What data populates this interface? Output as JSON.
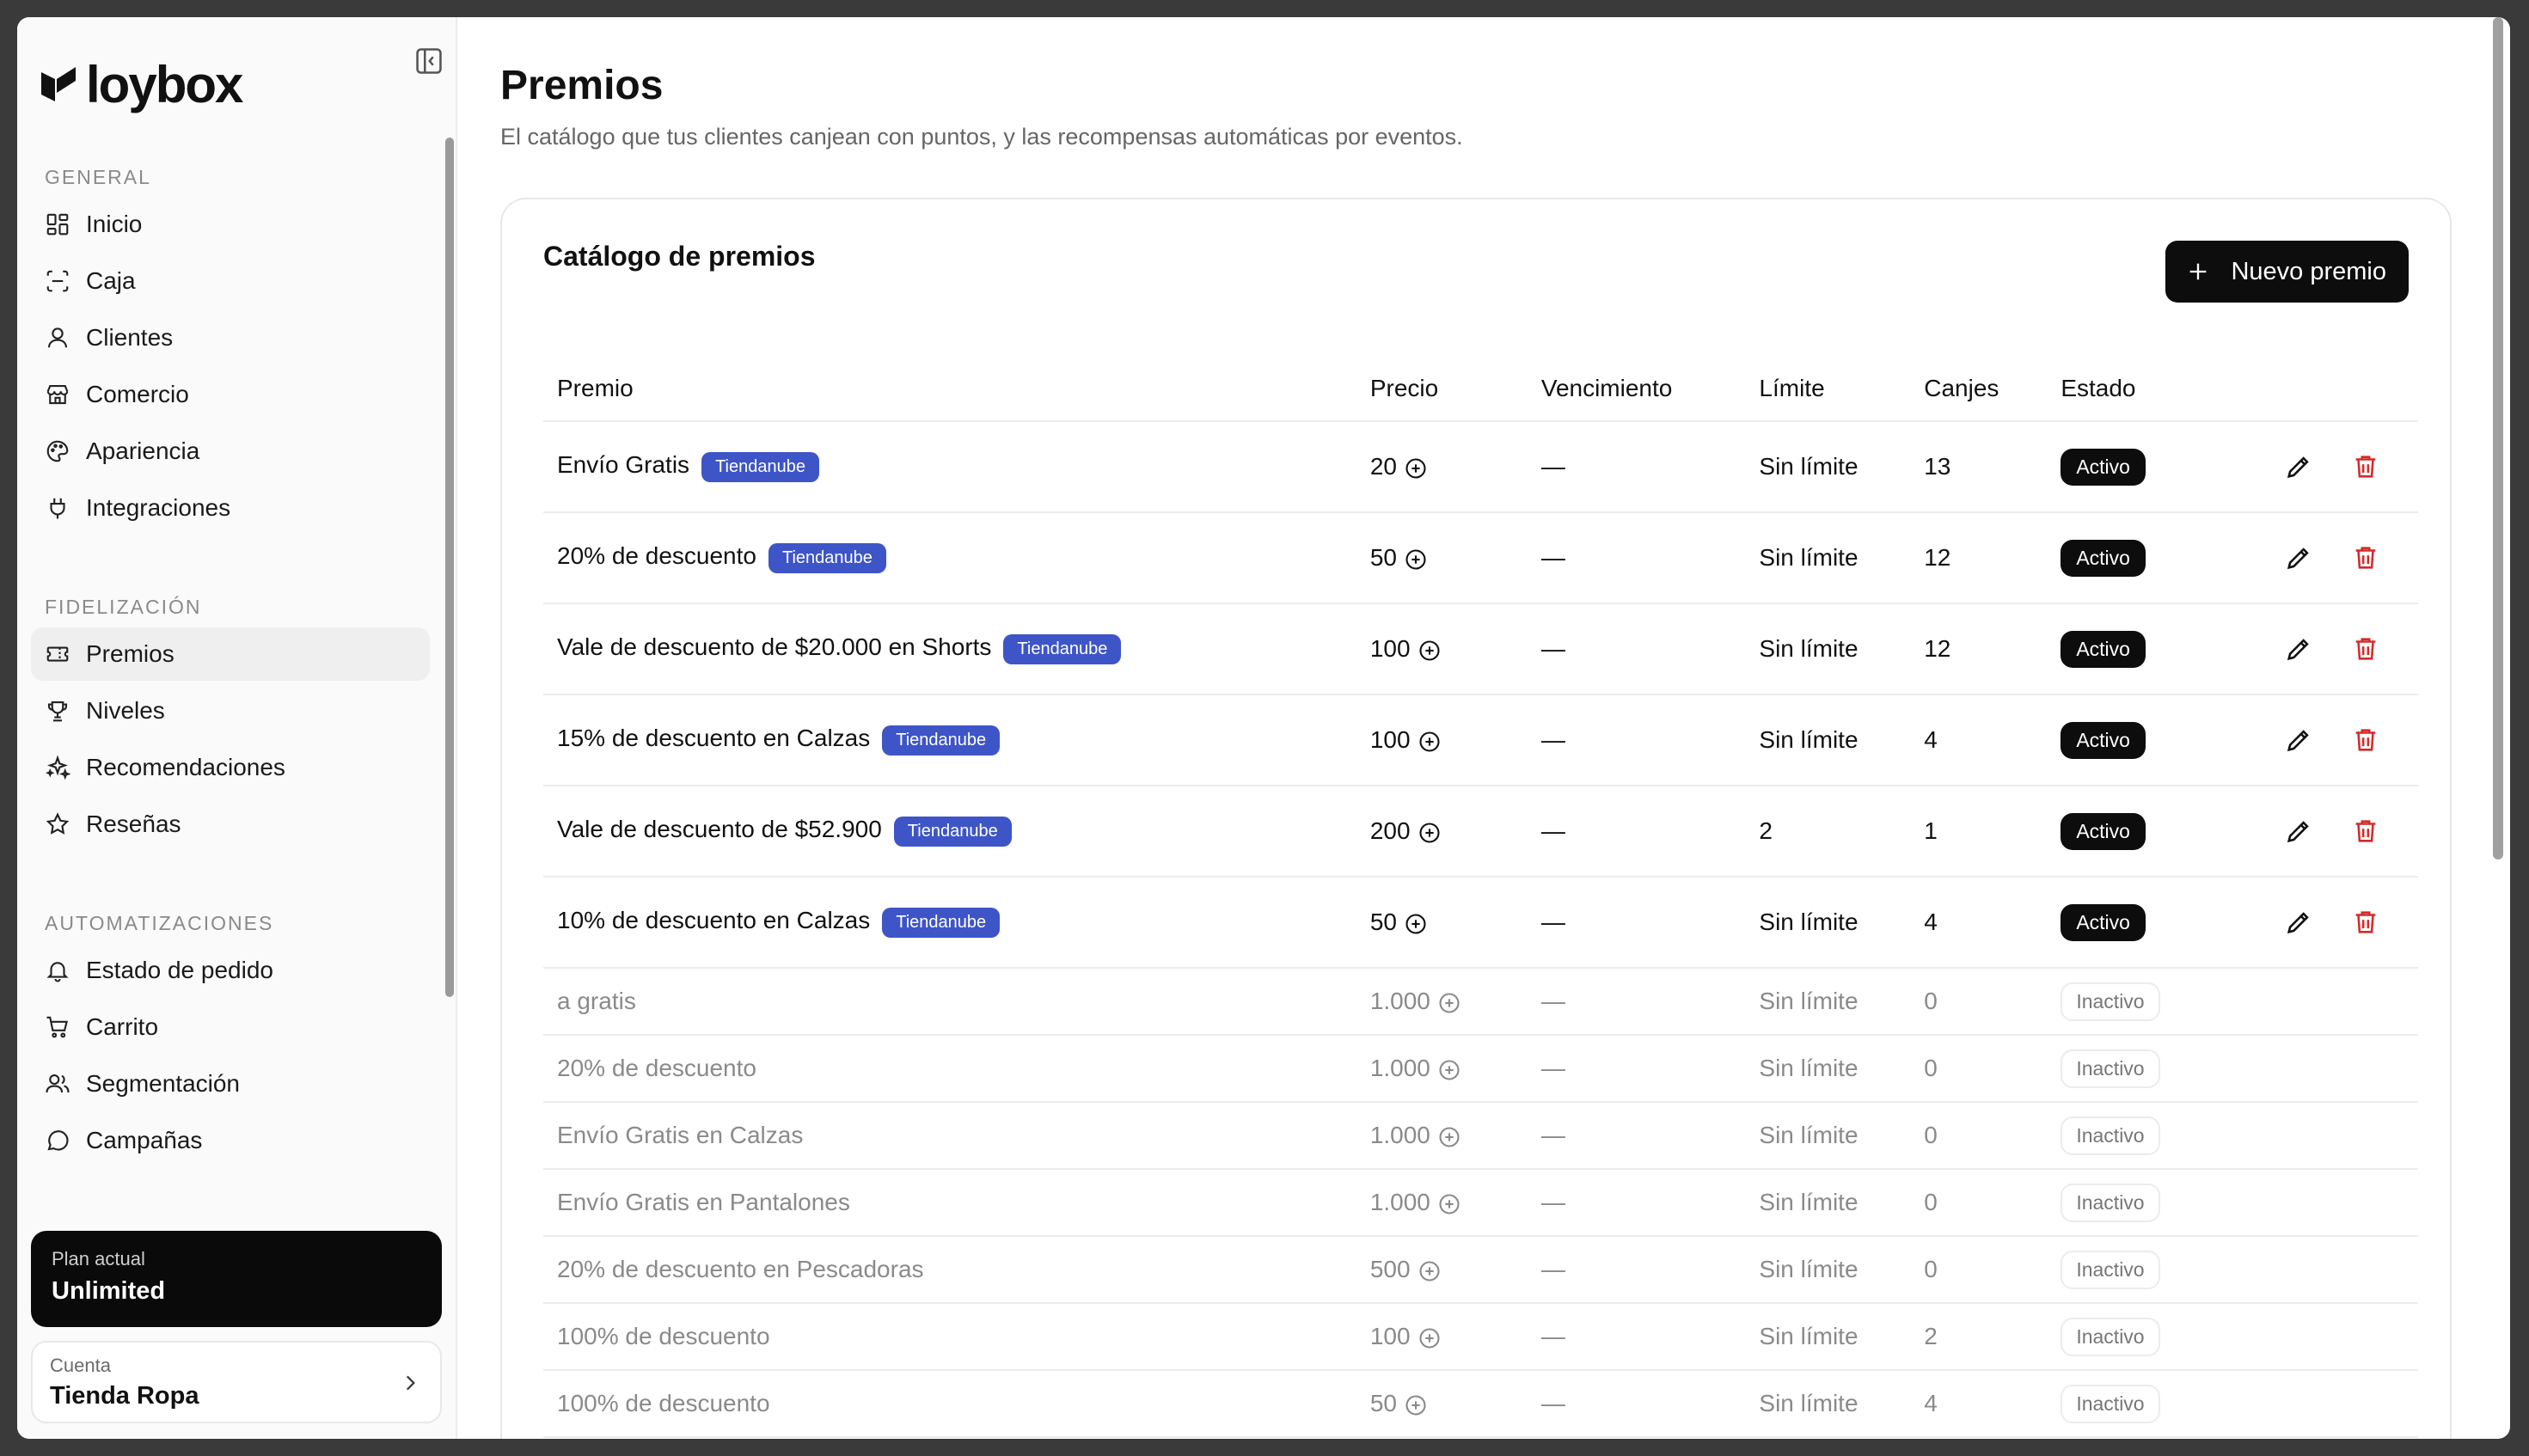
{
  "app": {
    "name": "loybox"
  },
  "sidebar": {
    "sections": [
      {
        "title": "GENERAL",
        "items": [
          {
            "label": "Inicio",
            "icon": "grid-icon"
          },
          {
            "label": "Caja",
            "icon": "scan-icon"
          },
          {
            "label": "Clientes",
            "icon": "user-icon"
          },
          {
            "label": "Comercio",
            "icon": "store-icon"
          },
          {
            "label": "Apariencia",
            "icon": "palette-icon"
          },
          {
            "label": "Integraciones",
            "icon": "plug-icon"
          }
        ]
      },
      {
        "title": "FIDELIZACIÓN",
        "items": [
          {
            "label": "Premios",
            "icon": "ticket-icon",
            "active": true
          },
          {
            "label": "Niveles",
            "icon": "trophy-icon"
          },
          {
            "label": "Recomendaciones",
            "icon": "sparkles-icon"
          },
          {
            "label": "Reseñas",
            "icon": "star-icon"
          }
        ]
      },
      {
        "title": "AUTOMATIZACIONES",
        "items": [
          {
            "label": "Estado de pedido",
            "icon": "bell-icon"
          },
          {
            "label": "Carrito",
            "icon": "cart-icon"
          },
          {
            "label": "Segmentación",
            "icon": "users-icon"
          },
          {
            "label": "Campañas",
            "icon": "chat-icon"
          }
        ]
      }
    ],
    "plan": {
      "label": "Plan actual",
      "value": "Unlimited"
    },
    "account": {
      "label": "Cuenta",
      "value": "Tienda Ropa"
    }
  },
  "page": {
    "title": "Premios",
    "subtitle": "El catálogo que tus clientes canjean con puntos, y las recompensas automáticas por eventos."
  },
  "catalog": {
    "title": "Catálogo de premios",
    "new_button": "Nuevo premio",
    "columns": [
      "Premio",
      "Precio",
      "Vencimiento",
      "Límite",
      "Canjes",
      "Estado"
    ],
    "rows": [
      {
        "name": "Envío Gratis",
        "badge": "Tiendanube",
        "price": "20",
        "expiry": "—",
        "limit": "Sin límite",
        "redeems": "13",
        "status": "Activo",
        "active": true
      },
      {
        "name": "20% de descuento",
        "badge": "Tiendanube",
        "price": "50",
        "expiry": "—",
        "limit": "Sin límite",
        "redeems": "12",
        "status": "Activo",
        "active": true
      },
      {
        "name": "Vale de descuento de $20.000 en Shorts",
        "badge": "Tiendanube",
        "price": "100",
        "expiry": "—",
        "limit": "Sin límite",
        "redeems": "12",
        "status": "Activo",
        "active": true
      },
      {
        "name": "15% de descuento en Calzas",
        "badge": "Tiendanube",
        "price": "100",
        "expiry": "—",
        "limit": "Sin límite",
        "redeems": "4",
        "status": "Activo",
        "active": true
      },
      {
        "name": "Vale de descuento de $52.900",
        "badge": "Tiendanube",
        "price": "200",
        "expiry": "—",
        "limit": "2",
        "redeems": "1",
        "status": "Activo",
        "active": true
      },
      {
        "name": "10% de descuento en Calzas",
        "badge": "Tiendanube",
        "price": "50",
        "expiry": "—",
        "limit": "Sin límite",
        "redeems": "4",
        "status": "Activo",
        "active": true
      },
      {
        "name": "a gratis",
        "badge": "",
        "price": "1.000",
        "expiry": "—",
        "limit": "Sin límite",
        "redeems": "0",
        "status": "Inactivo",
        "active": false
      },
      {
        "name": "20% de descuento",
        "badge": "",
        "price": "1.000",
        "expiry": "—",
        "limit": "Sin límite",
        "redeems": "0",
        "status": "Inactivo",
        "active": false
      },
      {
        "name": "Envío Gratis en Calzas",
        "badge": "",
        "price": "1.000",
        "expiry": "—",
        "limit": "Sin límite",
        "redeems": "0",
        "status": "Inactivo",
        "active": false
      },
      {
        "name": "Envío Gratis en Pantalones",
        "badge": "",
        "price": "1.000",
        "expiry": "—",
        "limit": "Sin límite",
        "redeems": "0",
        "status": "Inactivo",
        "active": false
      },
      {
        "name": "20% de descuento en Pescadoras",
        "badge": "",
        "price": "500",
        "expiry": "—",
        "limit": "Sin límite",
        "redeems": "0",
        "status": "Inactivo",
        "active": false
      },
      {
        "name": "100% de descuento",
        "badge": "",
        "price": "100",
        "expiry": "—",
        "limit": "Sin límite",
        "redeems": "2",
        "status": "Inactivo",
        "active": false
      },
      {
        "name": "100% de descuento",
        "badge": "",
        "price": "50",
        "expiry": "—",
        "limit": "Sin límite",
        "redeems": "4",
        "status": "Inactivo",
        "active": false
      }
    ]
  },
  "colors": {
    "accent_badge": "#3e55c7",
    "delete": "#d42a2a",
    "dark": "#0d0d0d"
  }
}
